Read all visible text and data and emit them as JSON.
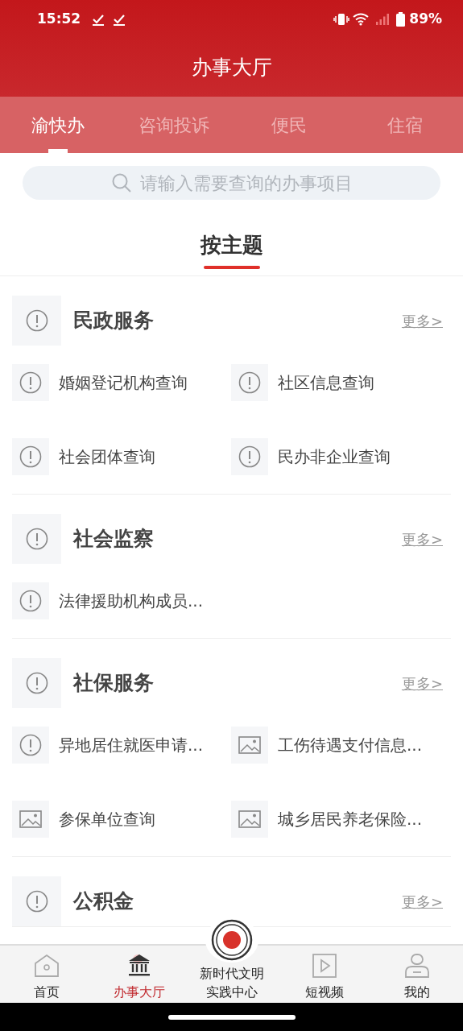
{
  "status_bar": {
    "time": "15:52",
    "battery": "89%"
  },
  "title": "办事大厅",
  "tabs": [
    {
      "label": "渝快办",
      "selected": true
    },
    {
      "label": "咨询投诉",
      "selected": false
    },
    {
      "label": "便民",
      "selected": false
    },
    {
      "label": "住宿",
      "selected": false
    }
  ],
  "search": {
    "placeholder": "请输入需要查询的办事项目"
  },
  "section_tab": {
    "label": "按主题",
    "selected": true
  },
  "sections": [
    {
      "title": "民政服务",
      "more": "更多>",
      "items": [
        {
          "label": "婚姻登记机构查询",
          "kind": "alert"
        },
        {
          "label": "社区信息查询",
          "kind": "alert"
        },
        {
          "label": "社会团体查询",
          "kind": "alert"
        },
        {
          "label": "民办非企业查询",
          "kind": "alert"
        }
      ]
    },
    {
      "title": "社会监察",
      "more": "更多>",
      "items": [
        {
          "label": "法律援助机构成员...",
          "kind": "alert"
        }
      ]
    },
    {
      "title": "社保服务",
      "more": "更多>",
      "items": [
        {
          "label": "异地居住就医申请...",
          "kind": "alert"
        },
        {
          "label": "工伤待遇支付信息...",
          "kind": "image"
        },
        {
          "label": "参保单位查询",
          "kind": "image"
        },
        {
          "label": "城乡居民养老保险...",
          "kind": "image"
        }
      ]
    },
    {
      "title": "公积金",
      "more": "更多>"
    }
  ],
  "bottom_nav": [
    {
      "label": "首页",
      "kind": "home",
      "selected": false
    },
    {
      "label": "办事大厅",
      "kind": "hall",
      "selected": true
    },
    {
      "label": "新时代文明实践中心",
      "kind": "emblem",
      "selected": false
    },
    {
      "label": "短视频",
      "kind": "video",
      "selected": false
    },
    {
      "label": "我的",
      "kind": "profile",
      "selected": false
    }
  ]
}
